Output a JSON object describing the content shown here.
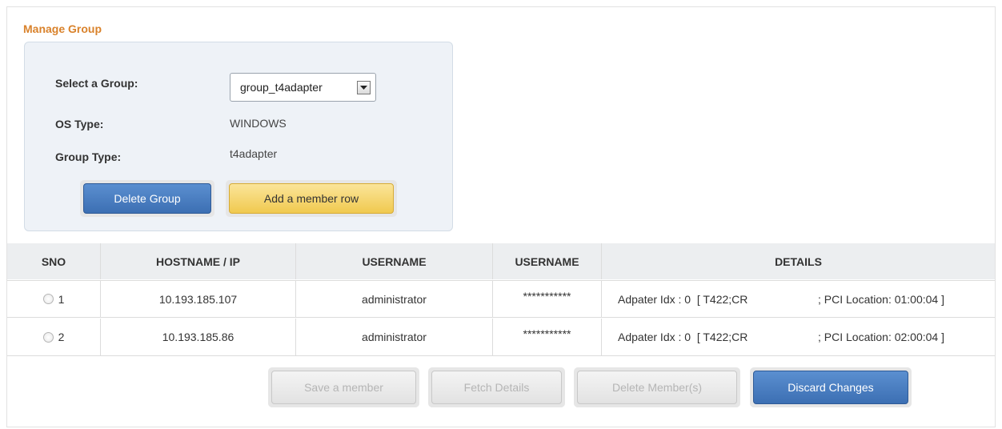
{
  "section_title": "Manage Group",
  "form": {
    "select_group_label": "Select a Group:",
    "selected_group": "group_t4adapter",
    "os_type_label": "OS Type:",
    "os_type_value": "WINDOWS",
    "group_type_label": "Group Type:",
    "group_type_value": "t4adapter"
  },
  "buttons": {
    "delete_group": "Delete Group",
    "add_member_row": "Add a member row",
    "save_member": "Save a member",
    "fetch_details": "Fetch Details",
    "delete_members": "Delete Member(s)",
    "discard_changes": "Discard Changes"
  },
  "table": {
    "headers": [
      "SNO",
      "HOSTNAME / IP",
      "USERNAME",
      "USERNAME",
      "DETAILS"
    ],
    "rows": [
      {
        "sno": "1",
        "host": "10.193.185.107",
        "username": "administrator",
        "password": "***********",
        "details_a": "Adpater Idx : 0  [ T422;CR",
        "details_b": "; PCI Location: 01:00:04 ]"
      },
      {
        "sno": "2",
        "host": "10.193.185.86",
        "username": "administrator",
        "password": "***********",
        "details_a": "Adpater Idx : 0  [ T422;CR",
        "details_b": "; PCI Location: 02:00:04 ]"
      }
    ]
  },
  "colors": {
    "title": "#d9822b",
    "primary_button": "#3c6fb3",
    "accent_button": "#f0c94f",
    "panel_bg": "#eef2f7"
  }
}
